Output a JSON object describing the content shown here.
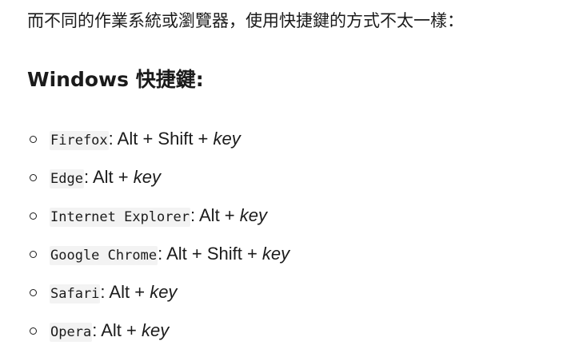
{
  "intro_text": "而不同的作業系統或瀏覽器，使用快捷鍵的方式不太一樣：",
  "heading": "Windows 快捷鍵:",
  "items": [
    {
      "browser": "Firefox",
      "combo": ": Alt + Shift + ",
      "key": "key"
    },
    {
      "browser": "Edge",
      "combo": ": Alt + ",
      "key": "key"
    },
    {
      "browser": "Internet Explorer",
      "combo": ": Alt + ",
      "key": "key"
    },
    {
      "browser": "Google Chrome",
      "combo": ": Alt + Shift + ",
      "key": "key"
    },
    {
      "browser": "Safari",
      "combo": ": Alt + ",
      "key": "key"
    },
    {
      "browser": "Opera",
      "combo": ": Alt + ",
      "key": "key"
    }
  ]
}
